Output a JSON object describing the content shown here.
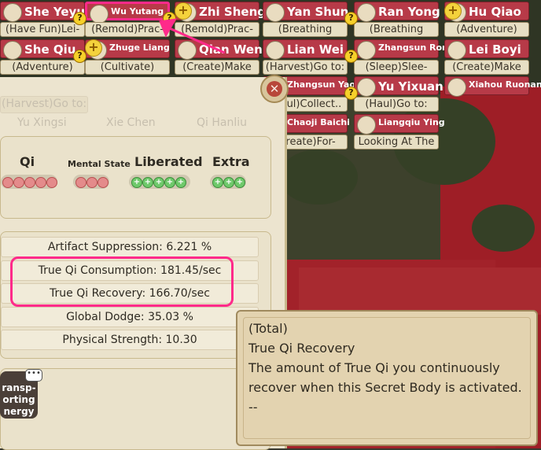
{
  "characters": [
    {
      "name": "She Yeyun",
      "status": "(Have Fun)Lei-",
      "col": 0,
      "row": 0,
      "small": false
    },
    {
      "name": "Wu Yutang",
      "status": "(Remold)Prac-",
      "col": 1,
      "row": 0,
      "small": true,
      "selected": true
    },
    {
      "name": "Zhi Sheng",
      "status": "(Remold)Prac-",
      "col": 2,
      "row": 0,
      "small": false
    },
    {
      "name": "Yan Shun",
      "status": "(Breathing",
      "col": 3,
      "row": 0,
      "small": false
    },
    {
      "name": "Ran Yong",
      "status": "(Breathing",
      "col": 4,
      "row": 0,
      "small": false
    },
    {
      "name": "Hu Qiao",
      "status": "(Adventure)",
      "col": 5,
      "row": 0,
      "small": false
    },
    {
      "name": "She Qiu",
      "status": "(Adventure)",
      "col": 0,
      "row": 1,
      "small": false
    },
    {
      "name": "Zhuge Liang",
      "status": "(Cultivate)",
      "col": 1,
      "row": 1,
      "small": true
    },
    {
      "name": "Qian Wen",
      "status": "(Create)Make",
      "col": 2,
      "row": 1,
      "small": false
    },
    {
      "name": "Lian Wei",
      "status": "(Harvest)Go to:",
      "col": 3,
      "row": 1,
      "small": false
    },
    {
      "name": "Zhangsun Rong",
      "status": "(Sleep)Slee-",
      "col": 4,
      "row": 1,
      "small": true
    },
    {
      "name": "Lei Boyi",
      "status": "(Create)Make",
      "col": 5,
      "row": 1,
      "small": false
    },
    {
      "name": "Zhangsun Yaorui",
      "status": "(Haul)Collect..",
      "col": 3,
      "row": 2,
      "small": true
    },
    {
      "name": "Yu Yixuan",
      "status": "(Haul)Go to:",
      "col": 4,
      "row": 2,
      "small": false
    },
    {
      "name": "Xiahou Ruonan",
      "status": "",
      "col": 5,
      "row": 2,
      "small": true
    },
    {
      "name": "Chaoji Baichi",
      "status": "(Create)For-",
      "col": 3,
      "row": 3,
      "small": true
    },
    {
      "name": "Liangqiu Ying",
      "status": "Looking At The",
      "col": 4,
      "row": 3,
      "small": true
    }
  ],
  "faded_names": [
    "Yu Xingsi",
    "Xie Chen",
    "Qi Hanliu"
  ],
  "faded_status": "(Harvest)Go to:",
  "stats_headers": {
    "qi": "Qi",
    "mental": "Mental State",
    "liberated": "Liberated",
    "extra": "Extra"
  },
  "attributes": [
    "Artifact Suppression: 6.221 %",
    "True Qi Consumption: 181.45/sec",
    "True Qi Recovery: 166.70/sec",
    "Global Dodge: 35.03 %",
    "Physical Strength: 10.30"
  ],
  "transport_text": [
    "ransp-",
    "orting",
    "nergy"
  ],
  "tooltip": {
    "line1": "(Total)",
    "line2": "True Qi Recovery",
    "line3": "The amount of True Qi you continuously",
    "line4": "recover when this Secret Body is activated.",
    "line5": "--"
  },
  "colors": {
    "highlight": "#ff2a8a",
    "name_bar": "#b73a48",
    "panel": "#ece4cf"
  }
}
